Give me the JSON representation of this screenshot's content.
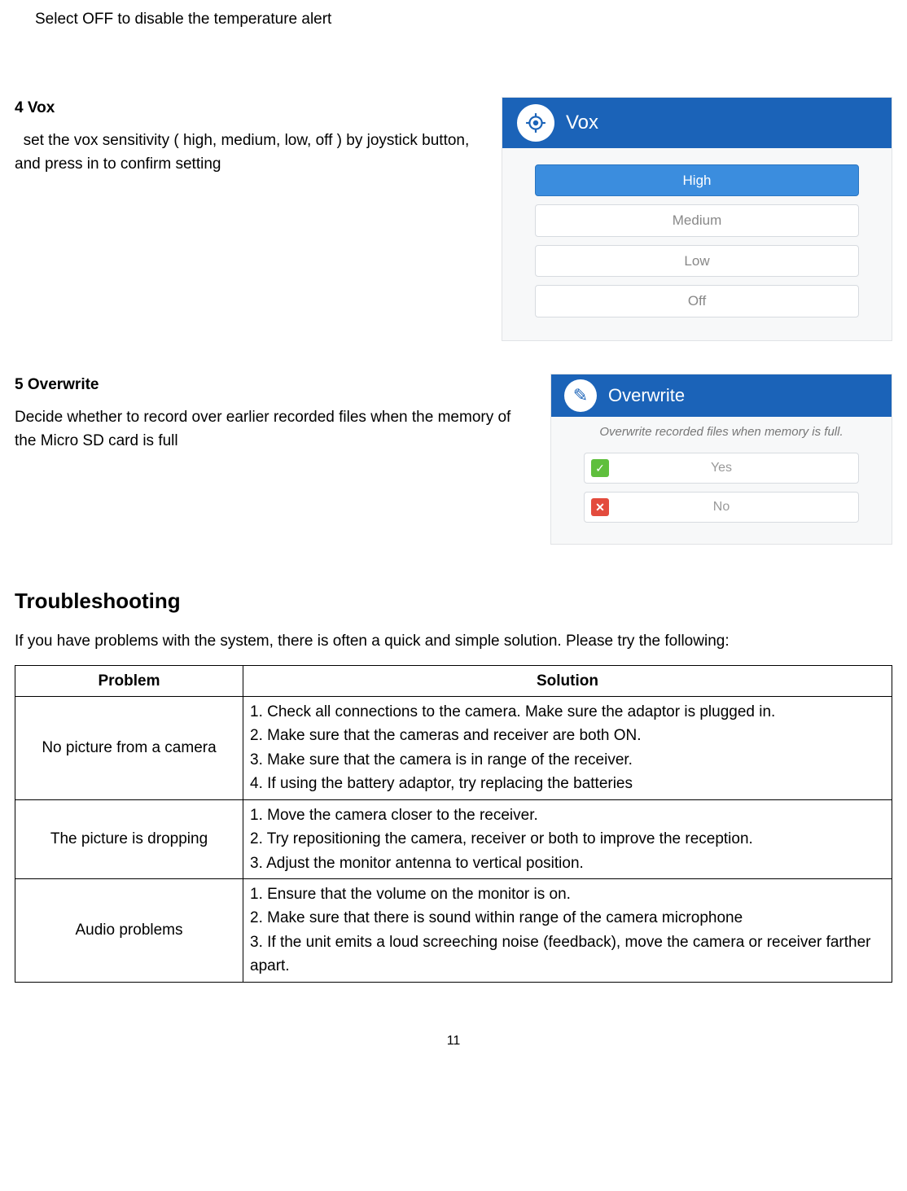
{
  "intro": "Select OFF to disable the temperature alert",
  "vox": {
    "heading": "4 Vox",
    "desc": "  set the vox sensitivity ( high, medium, low, off ) by joystick button, and press in to confirm setting",
    "panel": {
      "title": "Vox",
      "options": [
        "High",
        "Medium",
        "Low",
        "Off"
      ],
      "selected_index": 0
    }
  },
  "overwrite": {
    "heading": "5 Overwrite",
    "desc": "Decide whether to record over earlier recorded files when the memory of the Micro SD card is full",
    "panel": {
      "title": "Overwrite",
      "subtitle": "Overwrite recorded files when memory is full.",
      "yes": "Yes",
      "no": "No"
    }
  },
  "troubleshooting": {
    "heading": "Troubleshooting",
    "intro": "If you have problems with the system, there is often a quick and simple solution. Please try the following:",
    "columns": {
      "problem": "Problem",
      "solution": "Solution"
    },
    "rows": [
      {
        "problem": "No picture from a camera",
        "solution": "1. Check all connections to the camera. Make sure the adaptor is plugged in.\n2. Make sure that the cameras and receiver are both ON.\n3. Make sure that the camera is in range of the receiver.\n4. If using the battery adaptor, try replacing the batteries"
      },
      {
        "problem": "The picture is dropping",
        "solution": "1. Move the camera closer to the receiver.\n2. Try repositioning the camera, receiver or both to improve the reception.\n3. Adjust the monitor antenna to vertical position."
      },
      {
        "problem": "Audio problems",
        "solution": "1. Ensure that the volume on the monitor is on.\n2. Make sure that there is sound within range of the camera microphone\n3. If the unit emits a loud screeching noise (feedback), move the camera or receiver farther apart."
      }
    ]
  },
  "page_number": "11"
}
